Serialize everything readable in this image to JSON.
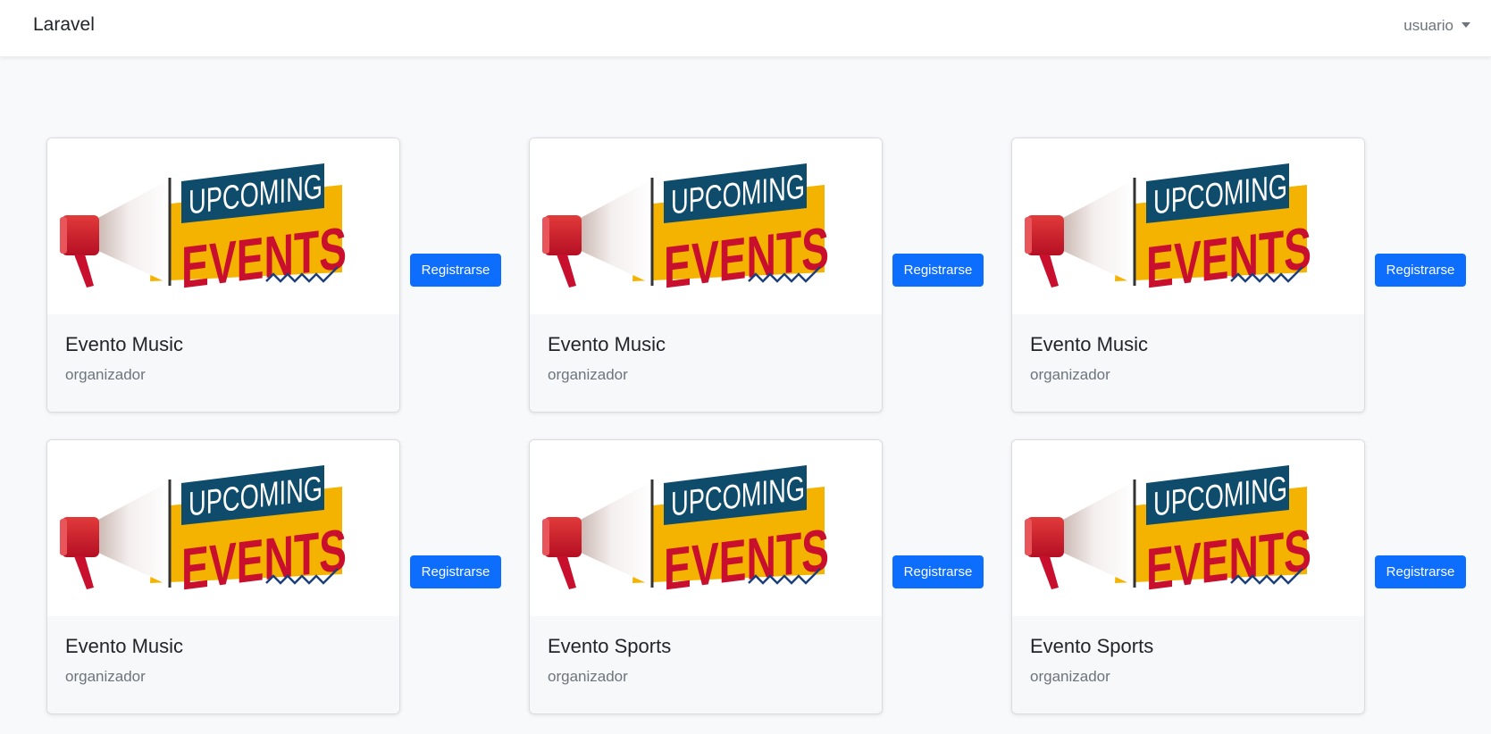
{
  "navbar": {
    "brand": "Laravel",
    "user": "usuario"
  },
  "events": [
    {
      "title": "Evento Music",
      "organizer": "organizador",
      "button": "Registrarse",
      "image": {
        "line1": "UPCOMING",
        "line2": "EVENTS"
      }
    },
    {
      "title": "Evento Music",
      "organizer": "organizador",
      "button": "Registrarse",
      "image": {
        "line1": "UPCOMING",
        "line2": "EVENTS"
      }
    },
    {
      "title": "Evento Music",
      "organizer": "organizador",
      "button": "Registrarse",
      "image": {
        "line1": "UPCOMING",
        "line2": "EVENTS"
      }
    },
    {
      "title": "Evento Music",
      "organizer": "organizador",
      "button": "Registrarse",
      "image": {
        "line1": "UPCOMING",
        "line2": "EVENTS"
      }
    },
    {
      "title": "Evento Sports",
      "organizer": "organizador",
      "button": "Registrarse",
      "image": {
        "line1": "UPCOMING",
        "line2": "EVENTS"
      }
    },
    {
      "title": "Evento Sports",
      "organizer": "organizador",
      "button": "Registrarse",
      "image": {
        "line1": "UPCOMING",
        "line2": "EVENTS"
      }
    }
  ],
  "colors": {
    "primary": "#0d6efd",
    "banner_teal": "#0f4c6b",
    "banner_yellow": "#f5b301",
    "banner_red": "#c8102e"
  }
}
